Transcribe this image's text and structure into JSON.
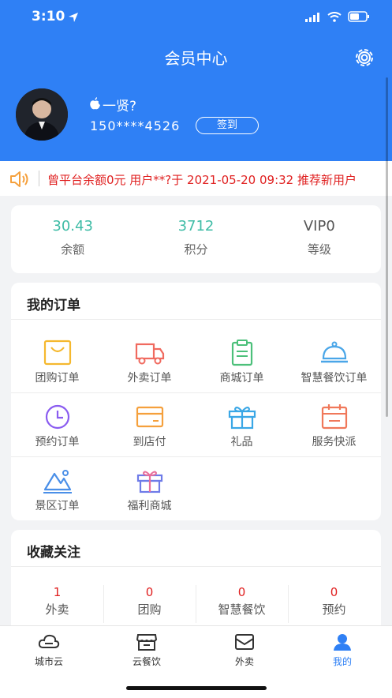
{
  "status": {
    "time": "3:10"
  },
  "header": {
    "title": "会员中心"
  },
  "profile": {
    "username": "一贤?",
    "phone": "150****4526",
    "signin_label": "签到"
  },
  "notice": {
    "text": "曾平台余额0元 用户**?于 2021-05-20 09:32 推荐新用户"
  },
  "stats": [
    {
      "value": "30.43",
      "label": "余额",
      "color": "#3fbca6"
    },
    {
      "value": "3712",
      "label": "积分",
      "color": "#3fbca6"
    },
    {
      "value": "VIP0",
      "label": "等级",
      "color": "#555555"
    }
  ],
  "orders": {
    "title": "我的订单",
    "items": [
      {
        "label": "团购订单",
        "icon": "shopping-bag-icon",
        "color": "#f5b82e"
      },
      {
        "label": "外卖订单",
        "icon": "delivery-truck-icon",
        "color": "#f06a5f"
      },
      {
        "label": "商城订单",
        "icon": "clipboard-icon",
        "color": "#4cc07a"
      },
      {
        "label": "智慧餐饮订单",
        "icon": "food-cloche-icon",
        "color": "#4aa6e8"
      },
      {
        "label": "预约订单",
        "icon": "clock-icon",
        "color": "#8a5cf0"
      },
      {
        "label": "到店付",
        "icon": "card-icon",
        "color": "#f5a03c"
      },
      {
        "label": "礼品",
        "icon": "gift-box-icon",
        "color": "#3aa7e6"
      },
      {
        "label": "服务快派",
        "icon": "calendar-icon",
        "color": "#f0785a"
      },
      {
        "label": "景区订单",
        "icon": "mountain-icon",
        "color": "#4a8fe8"
      },
      {
        "label": "福利商城",
        "icon": "gift-icon",
        "color": "#6e7be8"
      }
    ]
  },
  "favorites": {
    "title": "收藏关注",
    "items": [
      {
        "count": "1",
        "label": "外卖"
      },
      {
        "count": "0",
        "label": "团购"
      },
      {
        "count": "0",
        "label": "智慧餐饮"
      },
      {
        "count": "0",
        "label": "预约"
      }
    ]
  },
  "tabbar": [
    {
      "label": "城市云",
      "icon": "cloud-icon"
    },
    {
      "label": "云餐饮",
      "icon": "store-icon"
    },
    {
      "label": "外卖",
      "icon": "mail-icon"
    },
    {
      "label": "我的",
      "icon": "user-icon",
      "active": true
    }
  ],
  "colors": {
    "primary": "#2f80f5",
    "notice": "#e02020",
    "stat_value": "#3fbca6"
  }
}
